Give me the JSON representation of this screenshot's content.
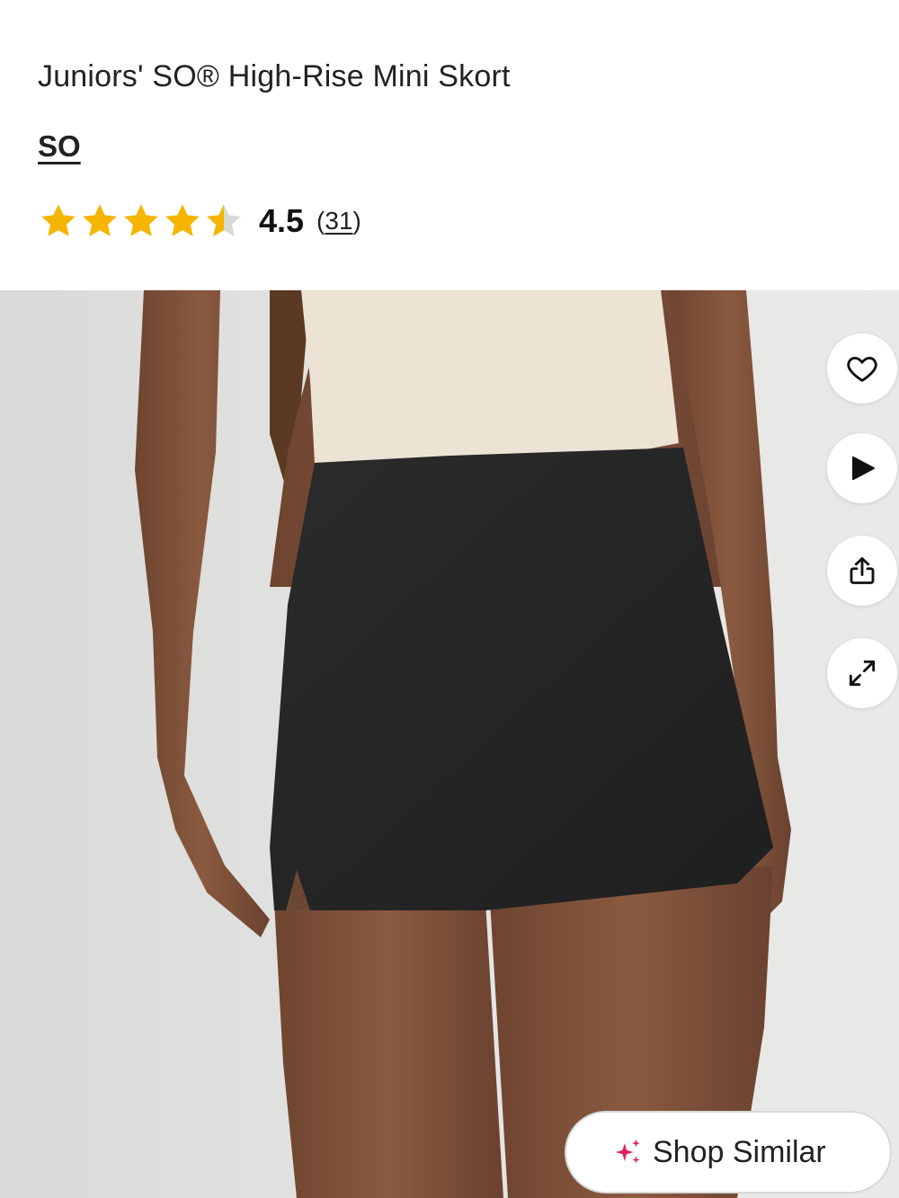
{
  "product": {
    "title": "Juniors' SO® High-Rise Mini Skort",
    "brand": "SO",
    "rating": {
      "value": "4.5",
      "stars_filled": 4.5,
      "stars_total": 5,
      "review_count": "31",
      "open_paren": "(",
      "close_paren": ")"
    }
  },
  "gallery": {
    "image_icon": "product-photo-skort",
    "actions": {
      "favorite_icon": "heart-icon",
      "video_icon": "play-icon",
      "share_icon": "share-icon",
      "expand_icon": "expand-icon"
    }
  },
  "shop_similar": {
    "label": "Shop Similar",
    "icon": "sparkle-icon"
  },
  "colors": {
    "star": "#f5b500",
    "star_empty": "#d9d9d9",
    "sparkle": "#e0205a",
    "text": "#222222"
  }
}
